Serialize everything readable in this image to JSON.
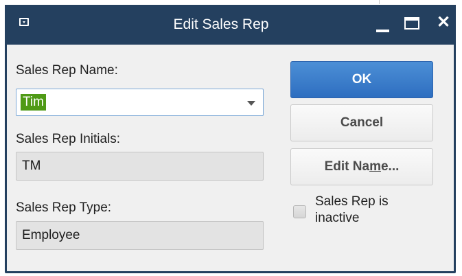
{
  "window": {
    "title": "Edit Sales Rep",
    "controls": {
      "system_menu": "system-menu-icon",
      "minimize": "minimize-icon",
      "maximize": "maximize-icon",
      "close_glyph": "✕"
    }
  },
  "form": {
    "name_label": "Sales Rep Name:",
    "name_value": "Tim",
    "initials_label": "Sales Rep Initials:",
    "initials_value": "TM",
    "type_label": "Sales Rep Type:",
    "type_value": "Employee"
  },
  "buttons": {
    "ok": "OK",
    "cancel": "Cancel",
    "edit_name_prefix": "Edit Na",
    "edit_name_underlined": "m",
    "edit_name_suffix": "e..."
  },
  "inactive_checkbox": {
    "label_line1": "Sales Rep is",
    "label_line2": "inactive",
    "checked": false
  },
  "colors": {
    "titlebar": "#24405f",
    "dialog_background": "#f0f0f0",
    "selection_highlight": "#4f9a16",
    "ok_button": "#3a7ccb"
  }
}
